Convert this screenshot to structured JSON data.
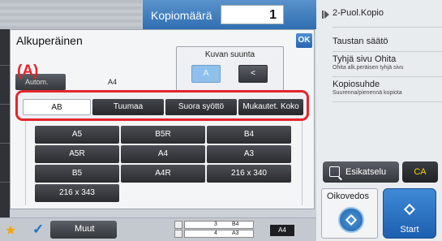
{
  "copy_count": {
    "label": "Kopiomäärä",
    "value": "1"
  },
  "dialog": {
    "title": "Alkuperäinen",
    "ok_label": "OK",
    "orientation": {
      "label": "Kuvan suunta",
      "portrait_glyph": "A",
      "landscape_glyph": "<"
    },
    "autom_label": "Autom.",
    "size_value": "A4",
    "callout": "(A)",
    "tabs": [
      {
        "label": "AB",
        "selected": true
      },
      {
        "label": "Tuumaa",
        "selected": false
      },
      {
        "label": "Suora syöttö",
        "selected": false
      },
      {
        "label": "Mukautet. Koko",
        "selected": false
      }
    ],
    "sizes": [
      "A5",
      "B5R",
      "B4",
      "A5R",
      "A4",
      "A3",
      "B5",
      "A4R",
      "216 x 340",
      "216 x 343"
    ]
  },
  "right_panel": {
    "items": [
      {
        "title": "2-Puol.Kopio",
        "subtitle": ""
      },
      {
        "title": "Taustan säätö",
        "subtitle": ""
      },
      {
        "title": "Tyhjä sivu Ohita",
        "subtitle": "Ohita alk.peräisen tyhjä sivu"
      },
      {
        "title": "Kopiosuhde",
        "subtitle": "Suurenna/pienennä kopiota"
      }
    ],
    "preview_label": "Esikatselu",
    "ca_label": "CA",
    "oikovedos_label": "Oikovedos",
    "start_label": "Start"
  },
  "bottom_bar": {
    "muut_label": "Muut",
    "trays": [
      {
        "number": "3",
        "size": "B4"
      },
      {
        "number": "4",
        "size": "A3"
      }
    ],
    "current_size": "A4"
  },
  "colors": {
    "accent_blue": "#2f6eb2",
    "callout_red": "#e3262b",
    "ca_yellow": "#f5d000"
  }
}
